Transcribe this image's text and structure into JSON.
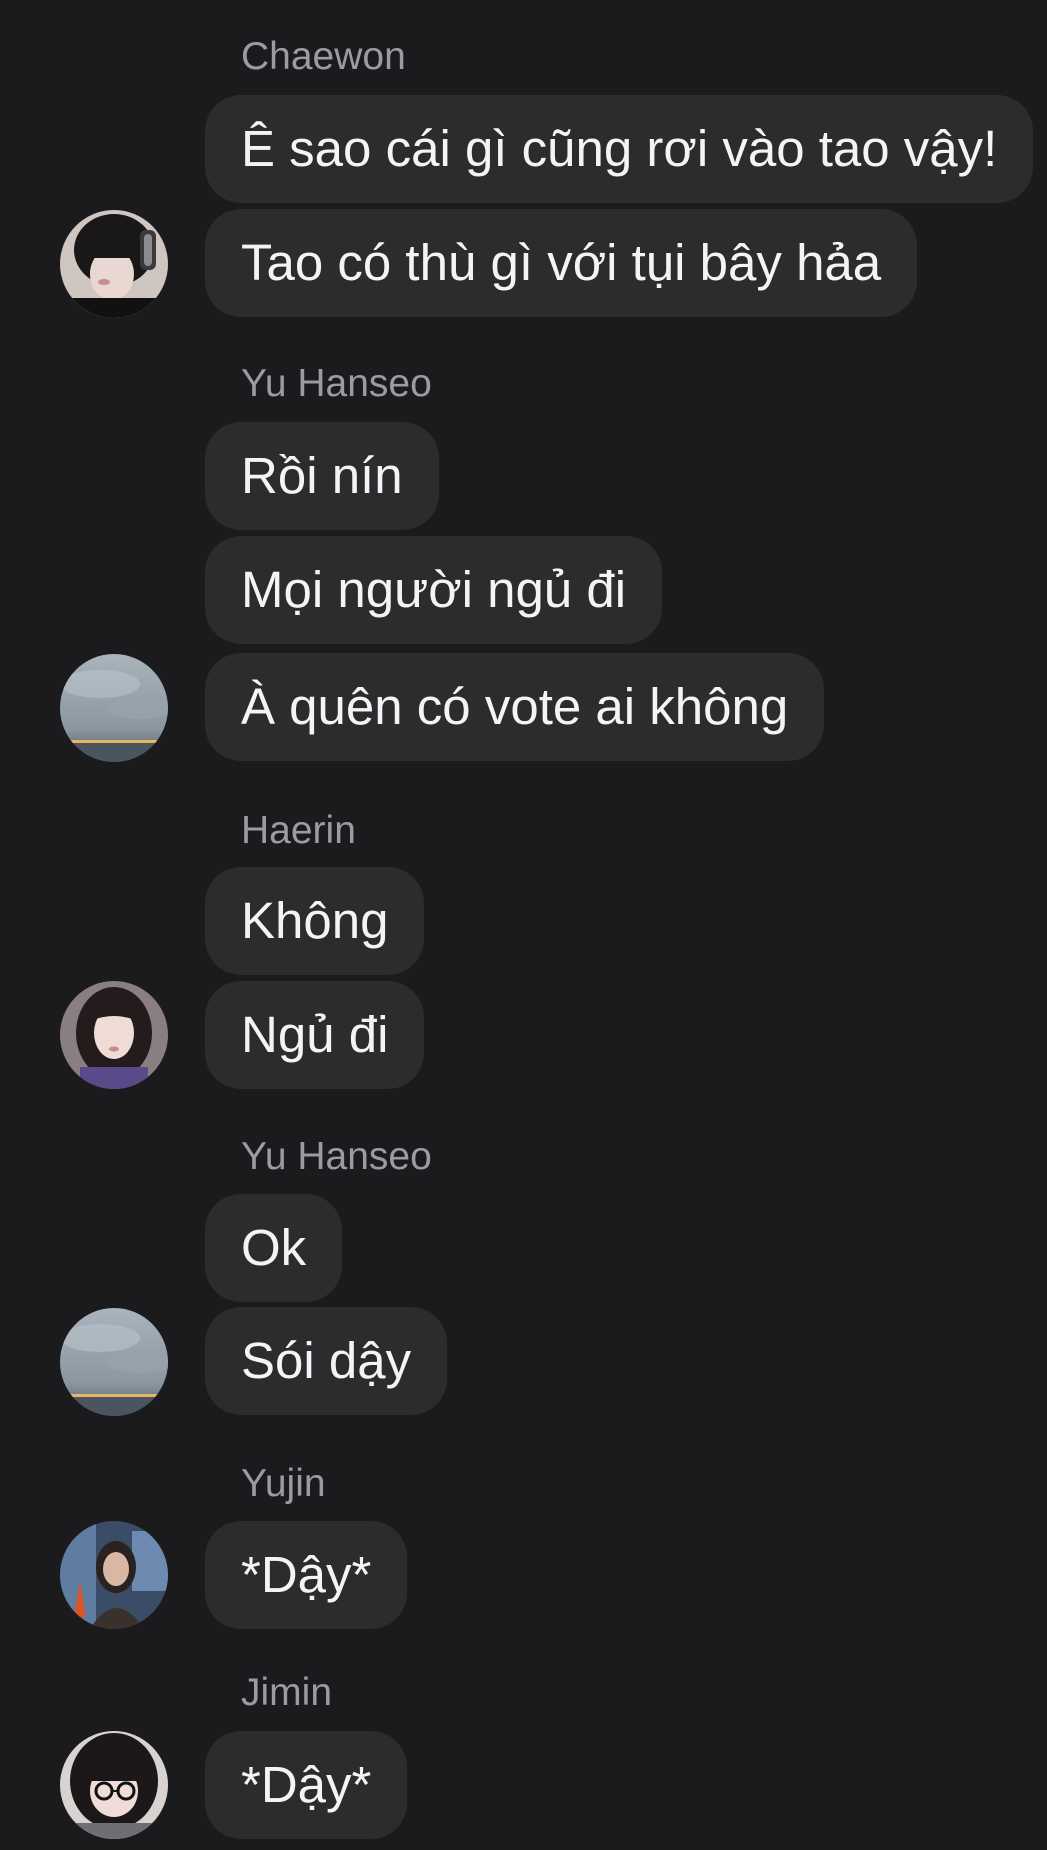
{
  "groups": [
    {
      "sender": "Chaewon",
      "avatar": "avatar-chaewon",
      "messages": [
        "Ê sao cái gì cũng rơi vào tao vậy!",
        "Tao có thù gì với tụi bây hảa"
      ]
    },
    {
      "sender": "Yu Hanseo",
      "avatar": "avatar-yu-hanseo",
      "messages": [
        "Rồi nín",
        "Mọi người ngủ đi",
        "À quên có vote ai không"
      ]
    },
    {
      "sender": "Haerin",
      "avatar": "avatar-haerin",
      "messages": [
        "Không",
        "Ngủ đi"
      ]
    },
    {
      "sender": "Yu Hanseo",
      "avatar": "avatar-yu-hanseo",
      "messages": [
        "Ok",
        "Sói dậy"
      ]
    },
    {
      "sender": "Yujin",
      "avatar": "avatar-yujin",
      "messages": [
        "*Dậy*"
      ]
    },
    {
      "sender": "Jimin",
      "avatar": "avatar-jimin",
      "messages": [
        "*Dậy*"
      ]
    }
  ],
  "colors": {
    "background": "#1b1b1d",
    "bubble": "#2c2c2f",
    "message_text": "#f4f4f6",
    "sender_text": "#9b9ba1"
  }
}
